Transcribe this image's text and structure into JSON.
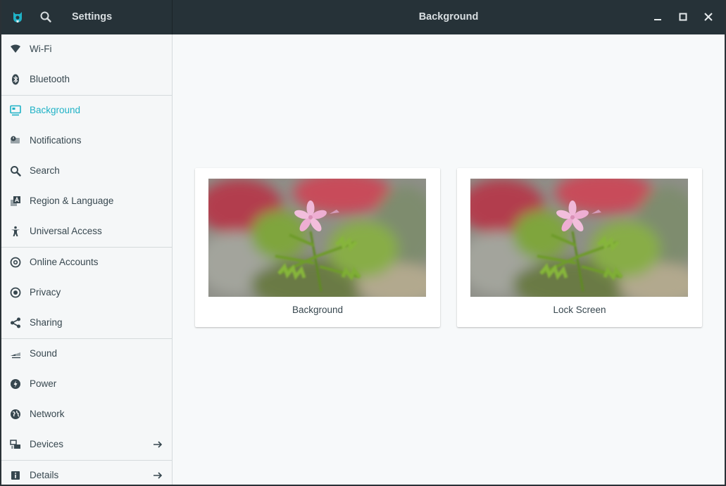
{
  "titlebar": {
    "app_icon": "settings-app-icon",
    "sidebar_title": "Settings",
    "main_title": "Background",
    "buttons": [
      "minimize-icon",
      "maximize-icon",
      "close-icon"
    ]
  },
  "sidebar": {
    "items": [
      {
        "label": "Wi-Fi",
        "icon": "wifi-icon"
      },
      {
        "label": "Bluetooth",
        "icon": "bluetooth-icon"
      },
      {
        "label": "Background",
        "icon": "background-icon",
        "active": true
      },
      {
        "label": "Notifications",
        "icon": "notifications-icon"
      },
      {
        "label": "Search",
        "icon": "search-icon"
      },
      {
        "label": "Region & Language",
        "icon": "region-icon"
      },
      {
        "label": "Universal Access",
        "icon": "universal-access-icon"
      },
      {
        "label": "Online Accounts",
        "icon": "online-accounts-icon"
      },
      {
        "label": "Privacy",
        "icon": "privacy-icon"
      },
      {
        "label": "Sharing",
        "icon": "sharing-icon"
      },
      {
        "label": "Sound",
        "icon": "sound-icon"
      },
      {
        "label": "Power",
        "icon": "power-icon"
      },
      {
        "label": "Network",
        "icon": "network-icon"
      },
      {
        "label": "Devices",
        "icon": "devices-icon",
        "has_arrow": true
      },
      {
        "label": "Details",
        "icon": "details-icon",
        "has_arrow": true
      }
    ]
  },
  "main": {
    "cards": [
      {
        "label": "Background"
      },
      {
        "label": "Lock Screen"
      }
    ]
  },
  "colors": {
    "titlebar": "#263238",
    "accent": "#1fb2c6",
    "text": "#37474f"
  }
}
